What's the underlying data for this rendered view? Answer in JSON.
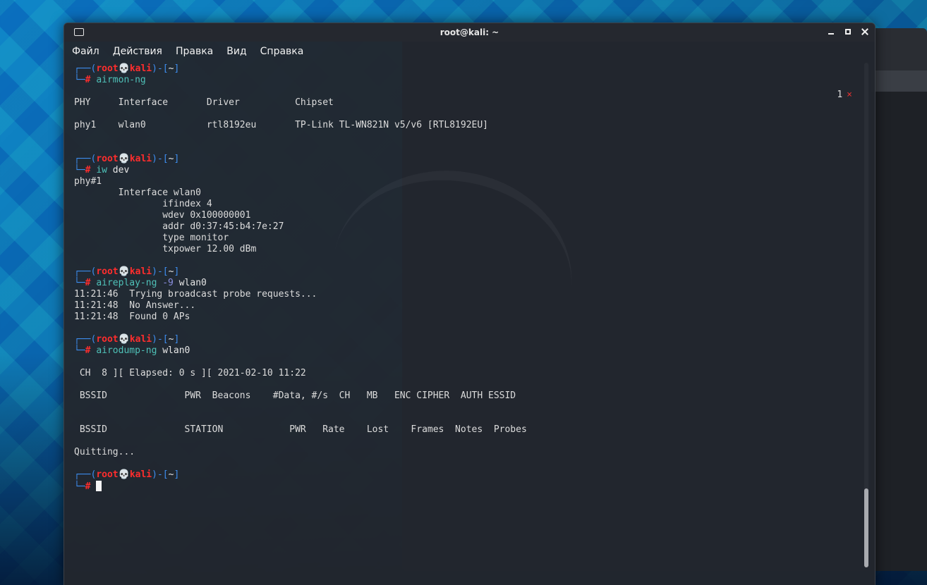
{
  "window": {
    "title": "root@kali: ~"
  },
  "menu": [
    "Файл",
    "Действия",
    "Правка",
    "Вид",
    "Справка"
  ],
  "tab_indicator": {
    "count": "1",
    "close": "×"
  },
  "prompt": {
    "open": "┌──(",
    "user": "root",
    "skull": "💀",
    "host": "kali",
    "mid": ")-[",
    "dir": "~",
    "close": "]",
    "hash_prefix": "└─",
    "hash": "#"
  },
  "blocks": [
    {
      "cmd": "airmon-ng",
      "args": "",
      "output": [
        "",
        "PHY     Interface       Driver          Chipset",
        "",
        "phy1    wlan0           rtl8192eu       TP-Link TL-WN821N v5/v6 [RTL8192EU]",
        "",
        ""
      ]
    },
    {
      "cmd": "iw",
      "args": " dev",
      "output": [
        "phy#1",
        "        Interface wlan0",
        "                ifindex 4",
        "                wdev 0x100000001",
        "                addr d0:37:45:b4:7e:27",
        "                type monitor",
        "                txpower 12.00 dBm",
        ""
      ]
    },
    {
      "cmd": "aireplay-ng",
      "opt": " -9",
      "args": " wlan0",
      "output": [
        "11:21:46  Trying broadcast probe requests...",
        "11:21:48  No Answer...",
        "11:21:48  Found 0 APs",
        ""
      ]
    },
    {
      "cmd": "airodump-ng",
      "args": " wlan0",
      "output": [
        "",
        " CH  8 ][ Elapsed: 0 s ][ 2021-02-10 11:22",
        "",
        " BSSID              PWR  Beacons    #Data, #/s  CH   MB   ENC CIPHER  AUTH ESSID",
        "",
        "",
        " BSSID              STATION            PWR   Rate    Lost    Frames  Notes  Probes",
        "",
        "Quitting...",
        ""
      ]
    }
  ]
}
